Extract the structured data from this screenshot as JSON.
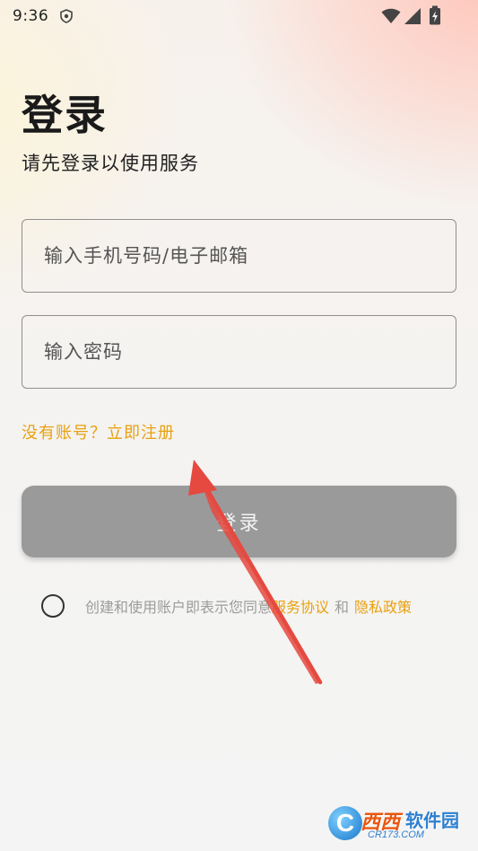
{
  "status_bar": {
    "time": "9:36",
    "icons": [
      "shield-icon",
      "wifi-icon",
      "signal-icon",
      "battery-charging-icon"
    ]
  },
  "page": {
    "title": "登录",
    "subtitle": "请先登录以使用服务"
  },
  "form": {
    "phone_placeholder": "输入手机号码/电子邮箱",
    "password_placeholder": "输入密码",
    "register_link": "没有账号？立即注册",
    "login_button": "登录"
  },
  "agreement": {
    "checked": false,
    "prefix": "创建和使用账户即表示您同意",
    "terms_link": "服务协议",
    "and": "和",
    "privacy_link": "隐私政策"
  },
  "watermark": {
    "badge": "C",
    "name": "西西",
    "name2": "软件园",
    "url": "CR173.COM"
  },
  "colors": {
    "accent": "#e8a10f",
    "button_disabled": "#9a9a9a",
    "arrow": "#e5493f"
  }
}
